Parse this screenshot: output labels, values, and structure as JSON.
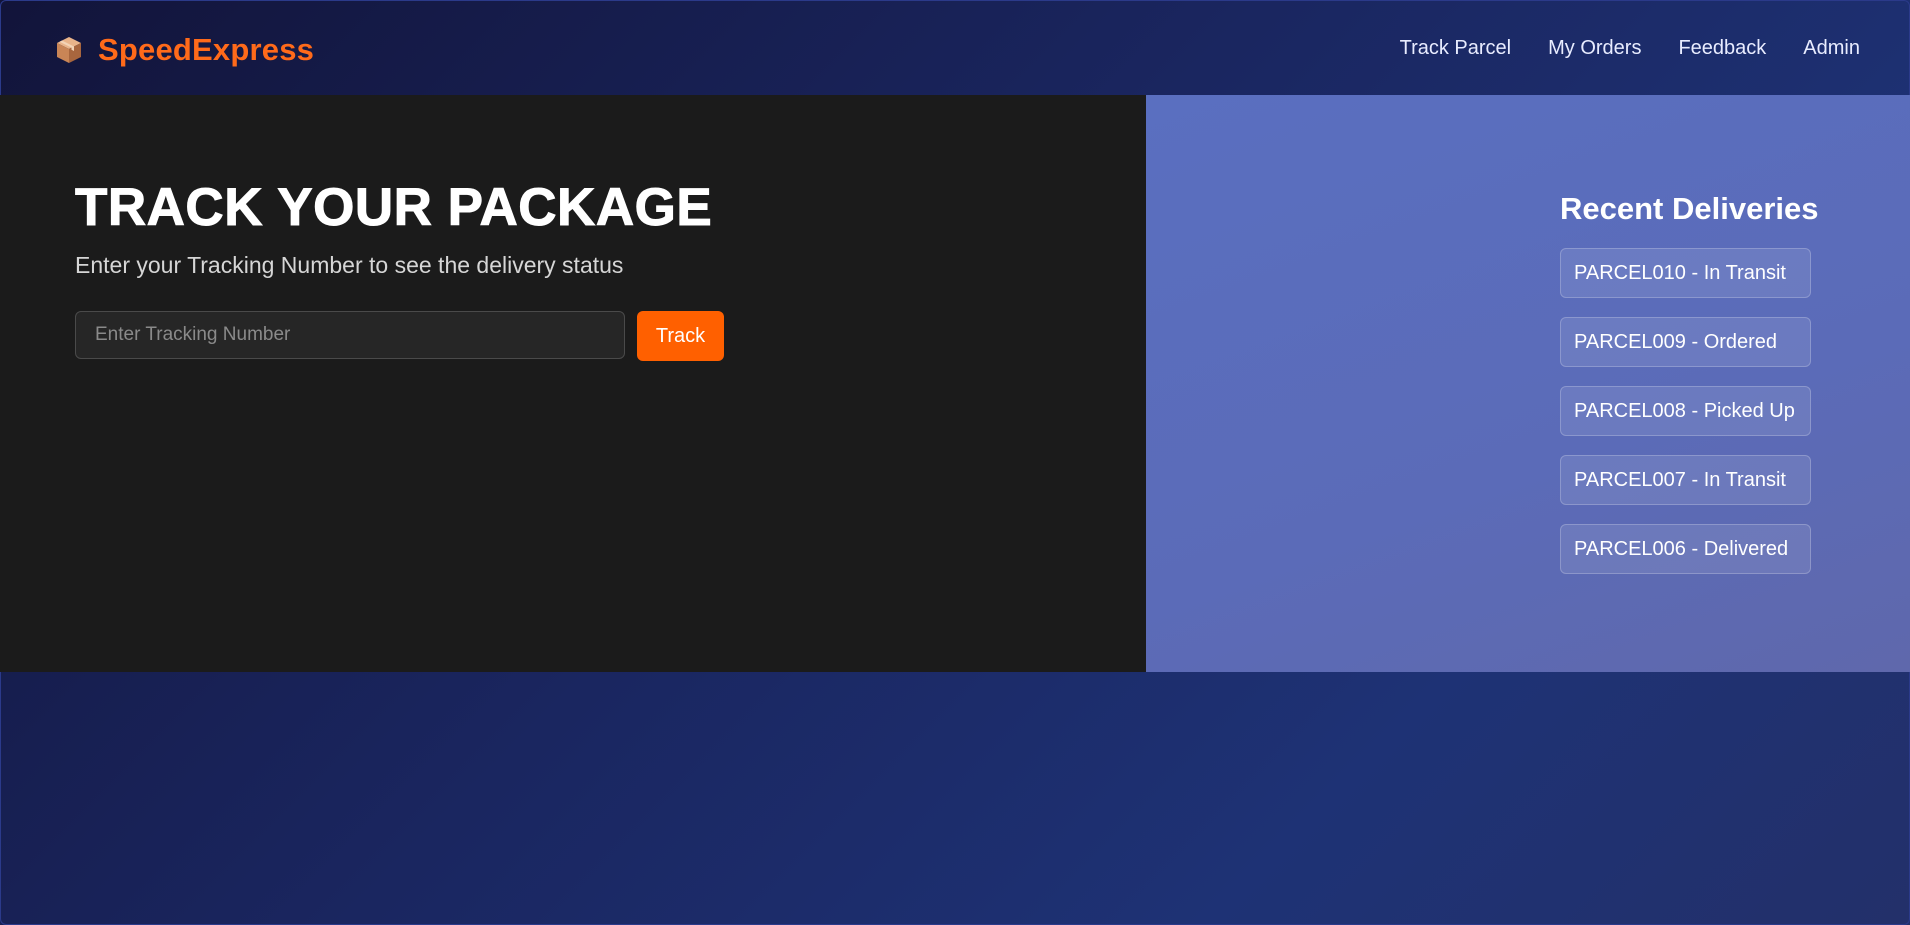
{
  "header": {
    "brand_name": "SpeedExpress",
    "brand_icon": "package-icon",
    "nav": [
      {
        "label": "Track Parcel"
      },
      {
        "label": "My Orders"
      },
      {
        "label": "Feedback"
      },
      {
        "label": "Admin"
      }
    ]
  },
  "hero": {
    "title": "TRACK YOUR PACKAGE",
    "subtitle": "Enter your Tracking Number to see the delivery status",
    "input_placeholder": "Enter Tracking Number",
    "input_value": "",
    "button_label": "Track"
  },
  "recent": {
    "title": "Recent Deliveries",
    "items": [
      {
        "label": "PARCEL010 - In Transit"
      },
      {
        "label": "PARCEL009 - Ordered"
      },
      {
        "label": "PARCEL008 - Picked Up"
      },
      {
        "label": "PARCEL007 - In Transit"
      },
      {
        "label": "PARCEL006 - Delivered"
      }
    ]
  },
  "colors": {
    "accent": "#ff6000",
    "brand": "#ff6a1a",
    "panel_dark": "#1b1b1b",
    "panel_blue": "#5a6fc0"
  }
}
